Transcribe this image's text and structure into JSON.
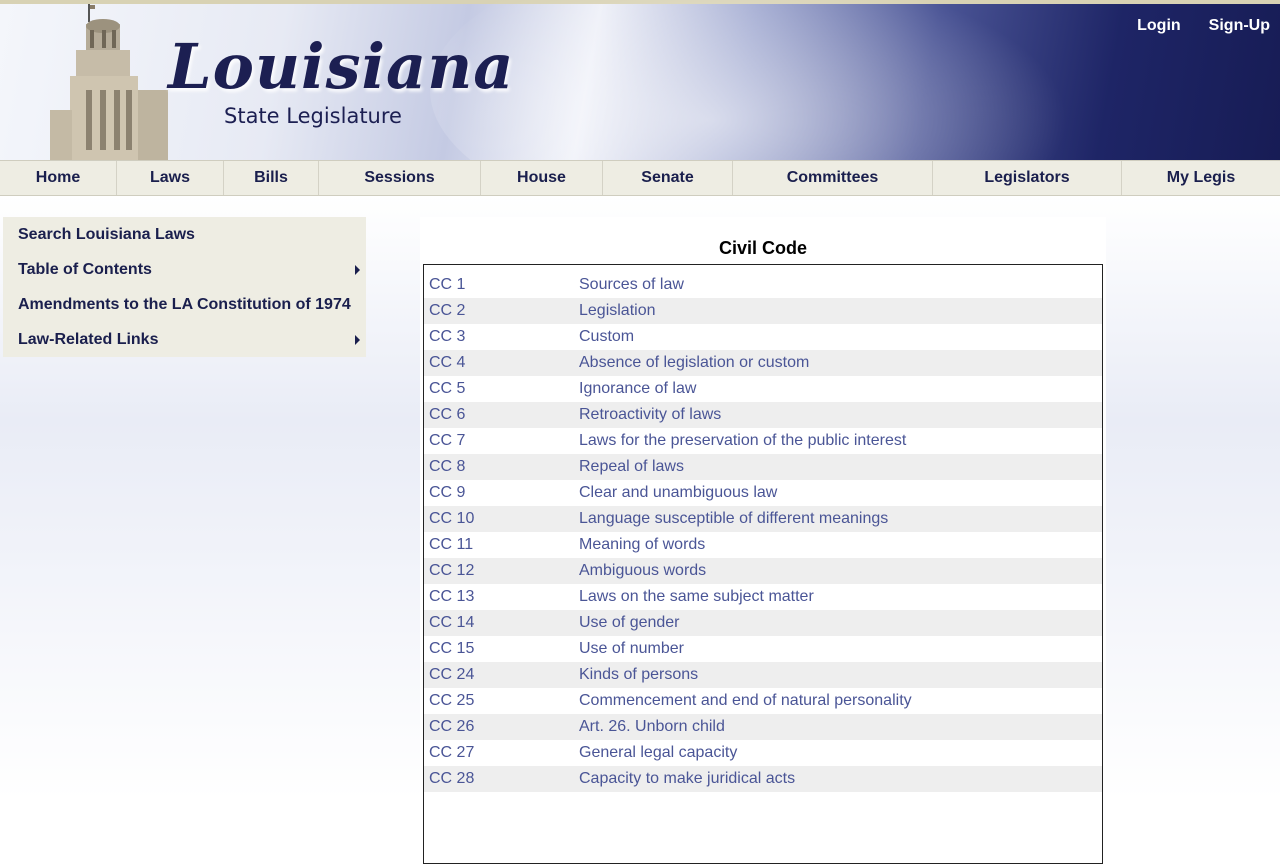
{
  "header": {
    "logo_title": "Louisiana",
    "logo_subtitle": "State Legislature",
    "login_label": "Login",
    "signup_label": "Sign-Up"
  },
  "nav": {
    "items": [
      {
        "label": "Home"
      },
      {
        "label": "Laws"
      },
      {
        "label": "Bills"
      },
      {
        "label": "Sessions"
      },
      {
        "label": "House"
      },
      {
        "label": "Senate"
      },
      {
        "label": "Committees"
      },
      {
        "label": "Legislators"
      },
      {
        "label": "My Legis"
      }
    ]
  },
  "sidebar": {
    "items": [
      {
        "label": "Search Louisiana Laws",
        "has_submenu": false
      },
      {
        "label": "Table of Contents",
        "has_submenu": true
      },
      {
        "label": "Amendments to the LA Constitution of 1974",
        "has_submenu": false
      },
      {
        "label": "Law-Related Links",
        "has_submenu": true
      }
    ]
  },
  "main": {
    "title": "Civil Code",
    "rows": [
      {
        "code": "CC 1",
        "title": "Sources of law"
      },
      {
        "code": "CC 2",
        "title": "Legislation"
      },
      {
        "code": "CC 3",
        "title": "Custom"
      },
      {
        "code": "CC 4",
        "title": "Absence of legislation or custom"
      },
      {
        "code": "CC 5",
        "title": "Ignorance of law"
      },
      {
        "code": "CC 6",
        "title": "Retroactivity of laws"
      },
      {
        "code": "CC 7",
        "title": "Laws for the preservation of the public interest"
      },
      {
        "code": "CC 8",
        "title": "Repeal of laws"
      },
      {
        "code": "CC 9",
        "title": "Clear and unambiguous law"
      },
      {
        "code": "CC 10",
        "title": "Language susceptible of different meanings"
      },
      {
        "code": "CC 11",
        "title": "Meaning of words"
      },
      {
        "code": "CC 12",
        "title": "Ambiguous words"
      },
      {
        "code": "CC 13",
        "title": "Laws on the same subject matter"
      },
      {
        "code": "CC 14",
        "title": "Use of gender"
      },
      {
        "code": "CC 15",
        "title": "Use of number"
      },
      {
        "code": "CC 24",
        "title": "Kinds of persons"
      },
      {
        "code": "CC 25",
        "title": "Commencement and end of natural personality"
      },
      {
        "code": "CC 26",
        "title": "Art. 26. Unborn child"
      },
      {
        "code": "CC 27",
        "title": "General legal capacity"
      },
      {
        "code": "CC 28",
        "title": "Capacity to make juridical acts"
      }
    ]
  },
  "colors": {
    "link": "#4a5596",
    "nav_text": "#1a1f4d",
    "nav_bg": "#eeede3",
    "banner_dark": "#171c55"
  }
}
